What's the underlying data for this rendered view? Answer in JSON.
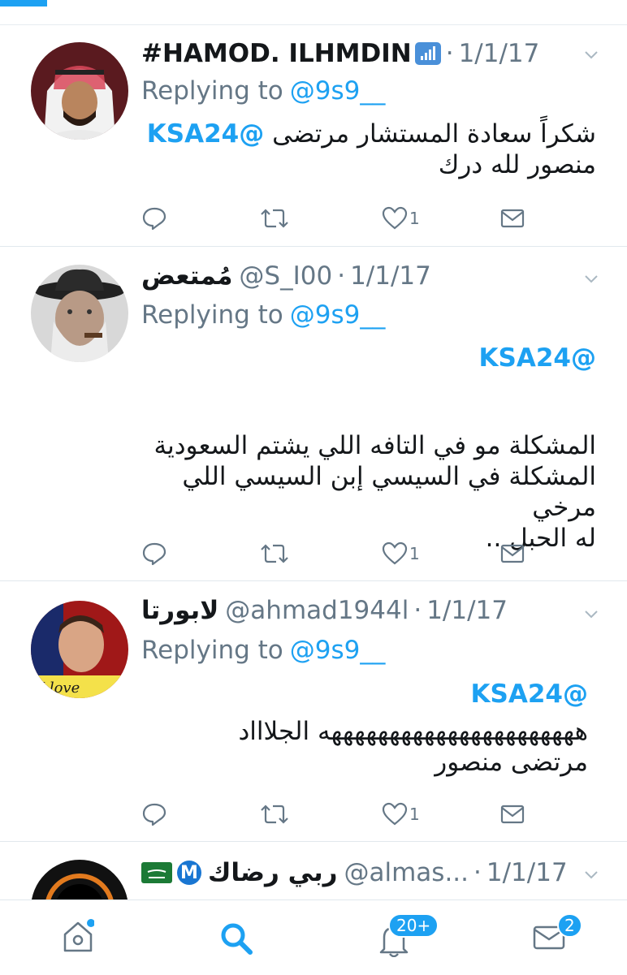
{
  "tweets": [
    {
      "name": "#HAMOD. ILHMDIN",
      "handle": "",
      "date": "1/1/17",
      "replying_label": "Replying to",
      "replying_to": "@9s9__",
      "mention": "@KSA24",
      "lines": [
        "شكراً سعادة المستشار مرتضى",
        "منصور لله درك"
      ],
      "like_count": "1"
    },
    {
      "name": "مُمتعض",
      "handle": "@S_I00",
      "date": "1/1/17",
      "replying_label": "Replying to",
      "replying_to": "@9s9__",
      "mention": "@KSA24",
      "lines": [
        "المشكلة مو في التافه اللي يشتم السعودية",
        "المشكلة في السيسي إبن السيسي اللي مرخي",
        "له الحبل .."
      ],
      "like_count": "1"
    },
    {
      "name": "لابورتا",
      "handle": "@ahmad1944l",
      "date": "1/1/17",
      "replying_label": "Replying to",
      "replying_to": "@9s9__",
      "mention": "@KSA24",
      "lines": [
        "ههههههههههههههههههههههه الجلاااد",
        "مرتضى منصور"
      ],
      "like_count": "1"
    },
    {
      "name": "ربي رضاك",
      "handle": "@almas...",
      "date": "1/1/17",
      "verified_letter": "M"
    }
  ],
  "tabbar": {
    "notifications_badge": "20+",
    "messages_badge": "2"
  },
  "icons": [
    "home-icon",
    "search-icon",
    "bell-icon",
    "mail-icon",
    "reply-icon",
    "retweet-icon",
    "heart-icon",
    "dm-icon",
    "chevron-down-icon",
    "signal-icon",
    "saudi-flag-icon"
  ],
  "colors": {
    "accent": "#1da1f2",
    "muted": "#657786",
    "text": "#14171a"
  }
}
